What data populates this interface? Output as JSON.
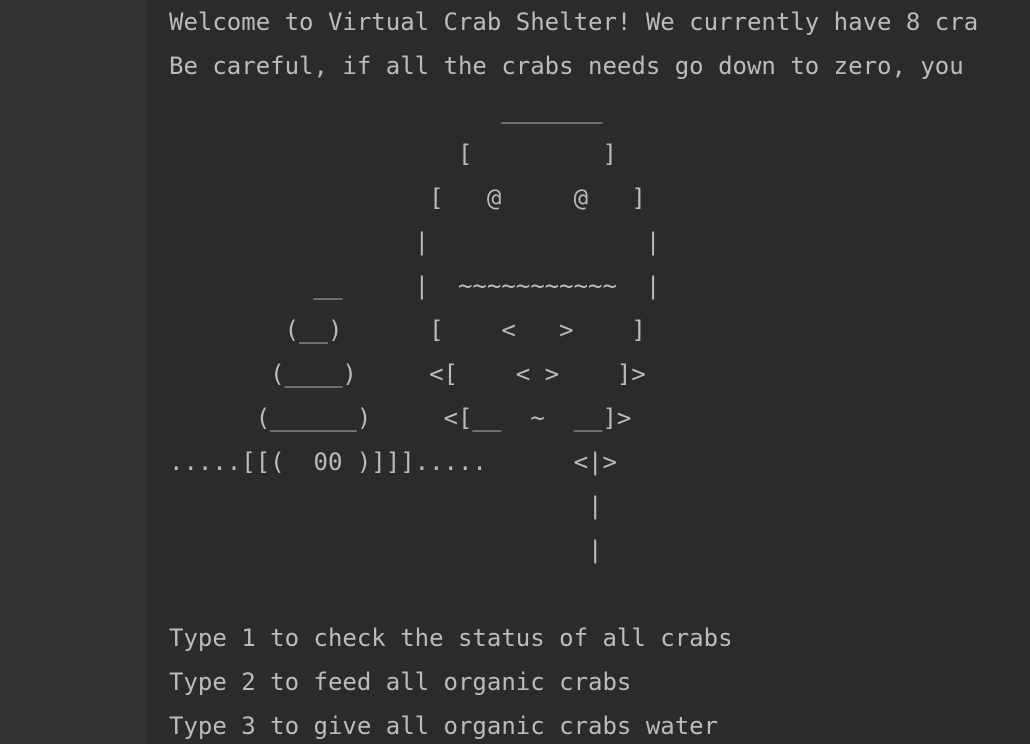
{
  "console": {
    "lines": [
      "Welcome to Virtual Crab Shelter! We currently have 8 cra",
      "Be careful, if all the crabs needs go down to zero, you",
      "                       _______",
      "                    [         ]",
      "                  [   @     @   ]",
      "                 |               |",
      "          __     |  ~~~~~~~~~~~  |",
      "        (__)      [    <   >    ]",
      "       (____)     <[    < >    ]>",
      "      (______)     <[__  ~  __]>",
      ".....[[(  00 )]]].....      <|>",
      "                             |",
      "                             |",
      "",
      "Type 1 to check the status of all crabs",
      "Type 2 to feed all organic crabs",
      "Type 3 to give all organic crabs water"
    ]
  }
}
